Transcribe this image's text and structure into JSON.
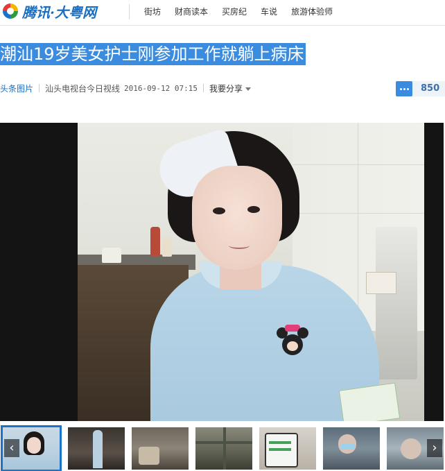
{
  "header": {
    "logo_text": "腾讯·大粤网",
    "nav": [
      "街坊",
      "财商读本",
      "买房纪",
      "车说",
      "旅游体验师"
    ]
  },
  "article": {
    "title": "潮汕19岁美女护士刚参加工作就躺上病床",
    "category": "头条图片",
    "source": "汕头电视台今日视线",
    "datetime": "2016-09-12 07:15",
    "share_label": "我要分享",
    "comment_count": "850"
  },
  "gallery": {
    "prev_symbol": "‹",
    "next_symbol": "›",
    "active_thumb": 1,
    "thumb_count": 7
  },
  "colors": {
    "brand_blue": "#1a6fc1",
    "title_highlight": "#3b8cdf",
    "thumb_active_border": "#1a73c8"
  }
}
